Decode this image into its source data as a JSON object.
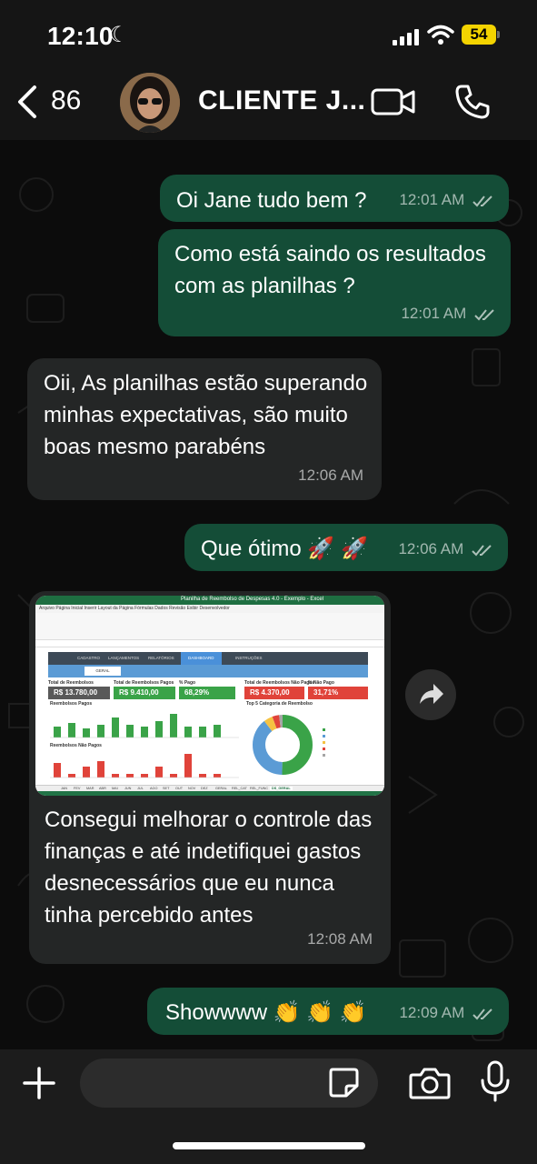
{
  "status_bar": {
    "time": "12:10",
    "battery": "54"
  },
  "header": {
    "back_count": "86",
    "contact_name": "CLIENTE J..."
  },
  "messages": [
    {
      "text": "Oi Jane tudo bem ?",
      "time": "12:01 AM"
    },
    {
      "text": "Como está saindo os resultados com as planilhas ?",
      "time": "12:01 AM"
    },
    {
      "text": "Oii, As planilhas estão superando minhas expectativas, são muito boas mesmo parabéns",
      "time": "12:06 AM"
    },
    {
      "text": "Que ótimo 🚀 🚀",
      "time": "12:06 AM"
    },
    {
      "text": "Consegui melhorar o controle das finanças e até indetifiquei gastos desnecessários que eu nunca tinha percebido antes",
      "time": "12:08 AM"
    },
    {
      "text": "Showwww 👏 👏 👏",
      "time": "12:09 AM"
    }
  ],
  "spreadsheet": {
    "window_title": "Planilha de Reembolso de Despesas 4.0 - Exemplo - Excel",
    "nav_tabs": [
      "CADASTRO",
      "LANÇAMENTOS",
      "RELATÓRIOS",
      "DASHBOARD",
      "INSTRUÇÕES"
    ],
    "filter_label": "GERAL",
    "kpis": [
      {
        "label": "Total de Reembolsos",
        "value": "R$ 13.780,00",
        "color": "#595959"
      },
      {
        "label": "Total de Reembolsos Pagos",
        "value": "R$ 9.410,00",
        "color": "#3aa348"
      },
      {
        "label": "% Pago",
        "value": "68,29%",
        "color": "#3aa348"
      },
      {
        "label": "Total de Reembolsos Não Pagos",
        "value": "R$ 4.370,00",
        "color": "#e0433a"
      },
      {
        "label": "% Não Pago",
        "value": "31,71%",
        "color": "#e0433a"
      }
    ],
    "chart_titles": [
      "Reembolsos Pagos",
      "Reembolsos Não Pagos",
      "Top 5 Categoria de Reembolso"
    ],
    "sheet_tabs": [
      "JAN",
      "FEV",
      "MAR",
      "ABR",
      "MAI",
      "JUN",
      "JUL",
      "AGO",
      "SET",
      "OUT",
      "NOV",
      "DEZ",
      "GERAL",
      "REL_CAT",
      "REL_FUNC",
      "DS_GERAL"
    ]
  },
  "input": {
    "placeholder": ""
  },
  "colors": {
    "outgoing": "#144d37",
    "incoming": "#242626",
    "background": "#0c0c0c"
  }
}
